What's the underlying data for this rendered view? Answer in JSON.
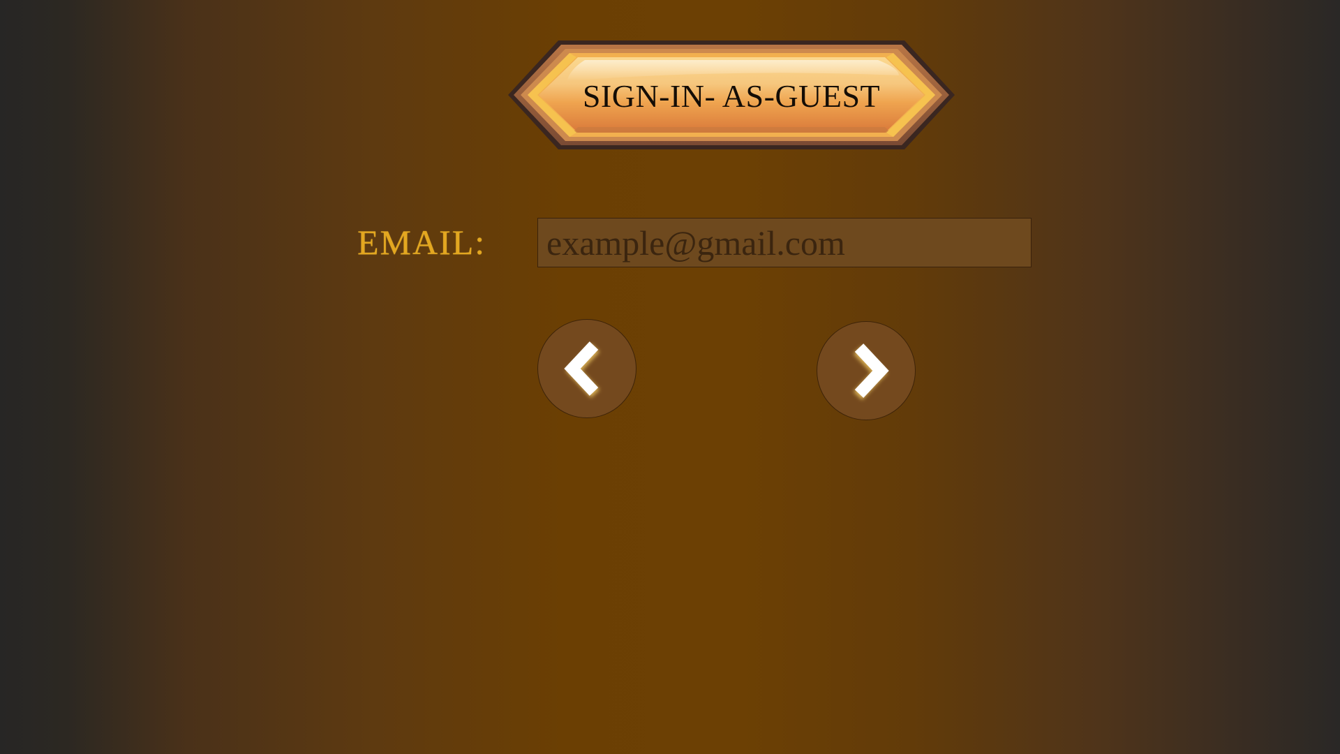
{
  "banner": {
    "title": "SIGN-IN- AS-GUEST"
  },
  "form": {
    "email_label": "EMAIL:",
    "email_placeholder": "example@gmail.com",
    "email_value": ""
  },
  "nav": {
    "back_icon": "chevron-left-icon",
    "next_icon": "chevron-right-icon"
  },
  "colors": {
    "background_center": "#6c4004",
    "background_edge": "#272625",
    "label_gold": "#e3a720",
    "input_fill": "#6e491e",
    "button_fill": "#74491e",
    "banner_gold": "#f0a347"
  }
}
